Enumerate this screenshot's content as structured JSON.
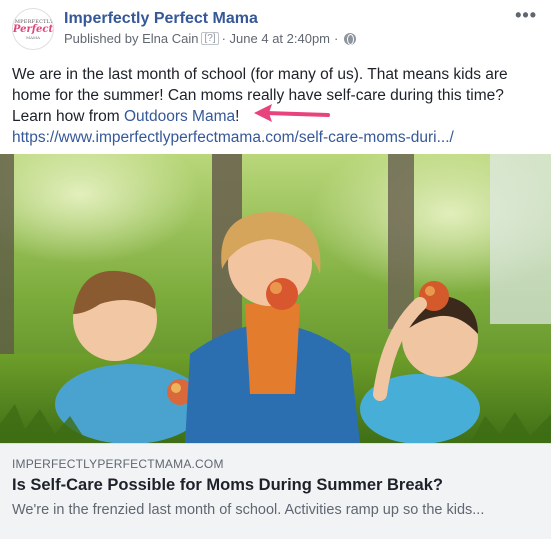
{
  "post": {
    "page_name": "Imperfectly Perfect Mama",
    "published_prefix": "Published by",
    "author": "Elna Cain",
    "help_mark": "[?]",
    "date": "June 4 at 2:40pm",
    "more_icon": "ellipsis-icon",
    "privacy_icon": "globe-icon",
    "text_1": "We are in the last month of school (for many of us). That means kids are home for the summer! Can moms really have self-care during this time? Learn how from ",
    "mention": "Outdoors Mama",
    "text_2": "!",
    "url": "https://www.imperfectlyperfectmama.com/self-care-moms-duri.../"
  },
  "avatar": {
    "line1": "IMPERFECTLY",
    "line2": "Perfect",
    "line3": "MAMA"
  },
  "preview": {
    "domain": "IMPERFECTLYPERFECTMAMA.COM",
    "title": "Is Self-Care Possible for Moms During Summer Break?",
    "description": "We're in the frenzied last month of school. Activities ramp up so the kids..."
  },
  "colors": {
    "link": "#365899",
    "arrow": "#e8437c"
  }
}
